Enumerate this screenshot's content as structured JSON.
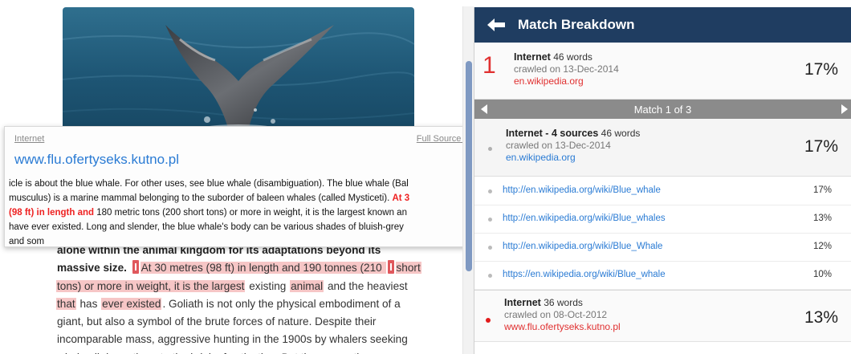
{
  "document": {
    "body_lines": [
      [
        {
          "t": "alone within the animal kingdom for its adaptations beyond its",
          "c": "bold"
        }
      ],
      [
        {
          "t": "massive size. ",
          "c": "bold"
        },
        {
          "t": "At 30 metres (98 ft) in length and 190 tonnes (210 ",
          "c": "hl"
        },
        {
          "t": "short",
          "c": "hl"
        }
      ],
      [
        {
          "t": "tons) or more in weight, it is the largest",
          "c": "hl"
        },
        {
          "t": " existing ",
          "c": ""
        },
        {
          "t": "animal",
          "c": "hl"
        },
        {
          "t": " and the heaviest",
          "c": ""
        }
      ],
      [
        {
          "t": "that",
          "c": "hl"
        },
        {
          "t": " has ",
          "c": ""
        },
        {
          "t": "ever existed",
          "c": "hl"
        },
        {
          "t": ". Goliath is not only the physical embodiment of a",
          "c": ""
        }
      ],
      [
        {
          "t": "giant, but also a symbol of the brute forces of nature. Despite their",
          "c": ""
        }
      ],
      [
        {
          "t": "incomparable mass, aggressive hunting in the 1900s by whalers seeking",
          "c": ""
        }
      ],
      [
        {
          "t": "whale oil drove them to the brink of extinction. But there are other",
          "c": ""
        }
      ]
    ]
  },
  "source_card": {
    "type_label": "Internet",
    "full_source_label": "Full Source T",
    "url": "www.flu.ofertyseks.kutno.pl",
    "lines": [
      [
        {
          "t": "icle is about the blue whale. For other uses, see blue whale (disambiguation). The blue whale (Bal",
          "c": ""
        }
      ],
      [
        {
          "t": "musculus) is a marine mammal belonging to the suborder of baleen whales (called Mysticeti). ",
          "c": ""
        },
        {
          "t": "At 3",
          "c": "red"
        }
      ],
      [
        {
          "t": "(98 ft) in length and",
          "c": "red"
        },
        {
          "t": " 180 metric tons (200 short tons) or more in weight, it is the largest known an",
          "c": ""
        }
      ],
      [
        {
          "t": "have ever existed. Long and slender, the blue whale's body can be various shades of bluish-grey",
          "c": ""
        }
      ],
      [
        {
          "t": "and som",
          "c": ""
        }
      ]
    ]
  },
  "panel": {
    "title": "Match Breakdown",
    "top_match": {
      "rank": "1",
      "source": "Internet",
      "words": "46 words",
      "crawled": "crawled on 13-Dec-2014",
      "domain": "en.wikipedia.org",
      "percent": "17%"
    },
    "nav": {
      "label": "Match 1 of 3"
    },
    "group": {
      "source": "Internet - 4 sources",
      "words": "46 words",
      "crawled": "crawled on 13-Dec-2014",
      "domain": "en.wikipedia.org",
      "percent": "17%"
    },
    "sub_sources": [
      {
        "url": "http://en.wikipedia.org/wiki/Blue_whale",
        "percent": "17%"
      },
      {
        "url": "http://en.wikipedia.org/wiki/Blue_whales",
        "percent": "13%"
      },
      {
        "url": "http://en.wikipedia.org/wiki/Blue_Whale",
        "percent": "12%"
      },
      {
        "url": "https://en.wikipedia.org/wiki/Blue_whale",
        "percent": "10%"
      }
    ],
    "bottom_match": {
      "source": "Internet",
      "words": "36 words",
      "crawled": "crawled on 08-Oct-2012",
      "domain": "www.flu.ofertyseks.kutno.pl",
      "percent": "13%"
    }
  },
  "colors": {
    "header_bg": "#1f3d61",
    "highlight": "#f6c6c6",
    "accent_red": "#e03030",
    "link_blue": "#2a7bd4",
    "nav_bg": "#8b8b8b",
    "scroll_thumb": "#7f99c2"
  },
  "icons": {
    "back": "arrow-left-icon",
    "prev": "triangle-left-icon",
    "next": "triangle-right-icon"
  }
}
